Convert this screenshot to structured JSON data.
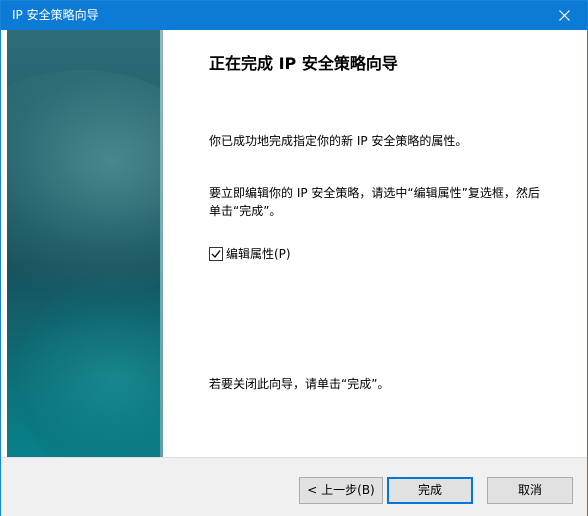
{
  "window": {
    "title": "IP 安全策略向导",
    "close_icon": "close-icon"
  },
  "wizard": {
    "heading": "正在完成 IP 安全策略向导",
    "completed_text": "你已成功地完成指定你的新 IP 安全策略的属性。",
    "edit_instruction": "要立即编辑你的 IP 安全策略，请选中“编辑属性”复选框，然后单击“完成”。",
    "edit_properties_checkbox": {
      "label": "编辑属性(P)",
      "checked": true
    },
    "close_instruction": "若要关闭此向导，请单击“完成”。"
  },
  "buttons": {
    "back_label": "< 上一步(B)",
    "finish_label": "完成",
    "cancel_label": "取消"
  },
  "colors": {
    "titlebar": "#0c7bd6",
    "accent": "#0078d7",
    "banner_teal": "#17525e"
  }
}
